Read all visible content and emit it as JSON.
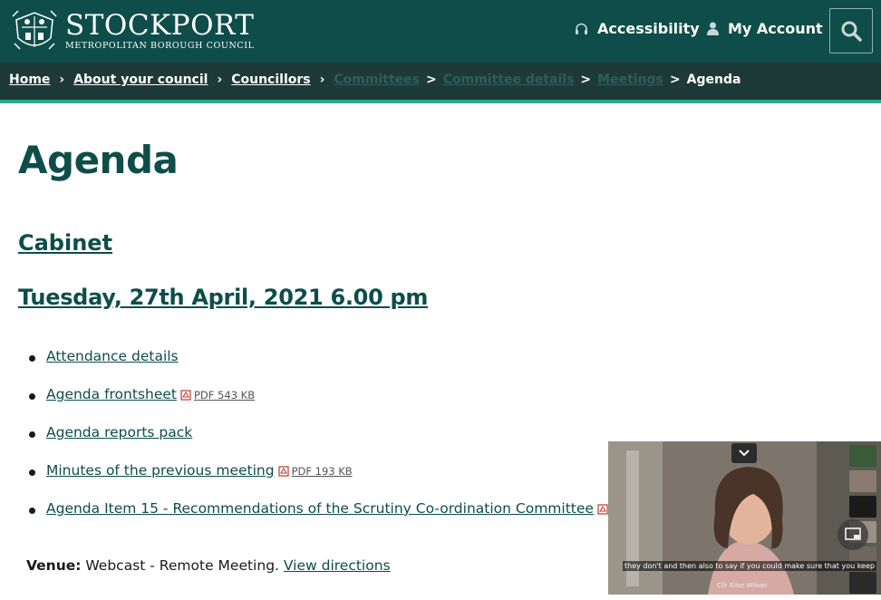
{
  "header": {
    "logo_name": "STOCKPORT",
    "logo_subtitle": "METROPOLITAN BOROUGH COUNCIL",
    "accessibility_label": "Accessibility",
    "account_label": "My Account",
    "brand_color": "#0e4d4a"
  },
  "breadcrumb": {
    "items": [
      "Home",
      "About your council",
      "Councillors",
      "Committees",
      "Committee details",
      "Meetings"
    ],
    "current": "Agenda"
  },
  "main": {
    "title": "Agenda",
    "committee": "Cabinet",
    "meeting_date": "Tuesday, 27th April, 2021 6.00 pm",
    "documents": [
      {
        "label": "Attendance details",
        "meta": ""
      },
      {
        "label": "Agenda frontsheet",
        "meta": "PDF 543 KB"
      },
      {
        "label": "Agenda reports pack",
        "meta": ""
      },
      {
        "label": "Minutes of the previous meeting",
        "meta": "PDF 193 KB"
      },
      {
        "label": "Agenda Item 15 - Recommendations of the Scrutiny Co-ordination Committee",
        "meta": "PD"
      }
    ],
    "venue_label": "Venue:",
    "venue_text": "Webcast - Remote Meeting.",
    "venue_link": "View directions"
  },
  "video": {
    "caption": "they don't and then also to say if you could make sure that you keep",
    "speaker": "Cllr Elise Wilson"
  }
}
